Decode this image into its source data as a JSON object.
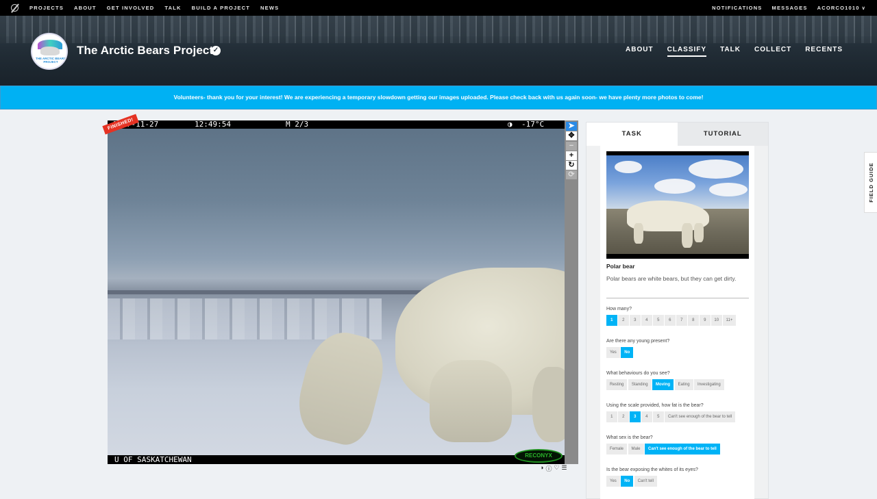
{
  "topnav": {
    "links": [
      "PROJECTS",
      "ABOUT",
      "GET INVOLVED",
      "TALK",
      "BUILD A PROJECT",
      "NEWS"
    ],
    "notifications": "NOTIFICATIONS",
    "messages": "MESSAGES",
    "user": "ACORCO1010"
  },
  "project": {
    "title": "The Arctic Bears Project",
    "avatar_text": "THE ARCTIC BEARS PROJECT",
    "nav": [
      "ABOUT",
      "CLASSIFY",
      "TALK",
      "COLLECT",
      "RECENTS"
    ],
    "active_nav": "CLASSIFY"
  },
  "banner": {
    "text": "Volunteers- thank you for your interest! We are experiencing a temporary slowdown getting our images uploaded. Please check back with us again soon- we have plenty more photos to come!"
  },
  "subject": {
    "badge": "FINISHED!",
    "cam_date": "2017-11-27",
    "cam_time": "12:49:54",
    "cam_frame": "M 2/3",
    "cam_temp": "-17°C",
    "cam_footer": "U OF SASKATCHEWAN",
    "cam_brand": "RECONYX"
  },
  "tools": [
    "pointer-icon",
    "pan-icon",
    "zoom-out-icon",
    "zoom-in-icon",
    "rotate-icon",
    "reset-icon"
  ],
  "task": {
    "tabs": [
      "TASK",
      "TUTORIAL"
    ],
    "species_name": "Polar bear",
    "species_desc": "Polar bears are white bears, but they can get dirty.",
    "questions": [
      {
        "label": "How many?",
        "options": [
          "1",
          "2",
          "3",
          "4",
          "5",
          "6",
          "7",
          "8",
          "9",
          "10",
          "11+"
        ],
        "selected": "1"
      },
      {
        "label": "Are there any young present?",
        "options": [
          "Yes",
          "No"
        ],
        "selected": "No"
      },
      {
        "label": "What behaviours do you see?",
        "options": [
          "Resting",
          "Standing",
          "Moving",
          "Eating",
          "Investigating"
        ],
        "selected": "Moving"
      },
      {
        "label": "Using the scale provided, how fat is the bear?",
        "options": [
          "1",
          "2",
          "3",
          "4",
          "5",
          "Can't see enough of the bear to tell"
        ],
        "selected": "3"
      },
      {
        "label": "What sex is the bear?",
        "options": [
          "Female",
          "Male",
          "Can't see enough of the bear to tell"
        ],
        "selected": "Can't see enough of the bear to tell"
      },
      {
        "label": "Is the bear exposing the whites of its eyes?",
        "options": [
          "Yes",
          "No",
          "Can't tell"
        ],
        "selected": "No"
      }
    ]
  },
  "field_guide": "FIELD GUIDE"
}
